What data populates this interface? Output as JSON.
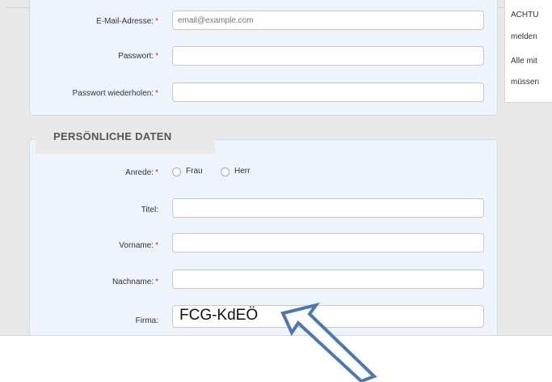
{
  "account": {
    "email_label": "E-Mail-Adresse:",
    "email_placeholder": "email@example.com",
    "password_label": "Passwort:",
    "password_repeat_label": "Passwort wiederholen:",
    "required_mark": "*"
  },
  "personal": {
    "legend": "PERSÖNLICHE DATEN",
    "salutation_label": "Anrede:",
    "option_frau": "Frau",
    "option_herr": "Herr",
    "title_label": "Titel:",
    "firstname_label": "Vorname:",
    "lastname_label": "Nachname:",
    "company_label": "Firma:",
    "company_value": "FCG-KdEÖ"
  },
  "side_note": {
    "line1": "ACHTU",
    "line2": "melden",
    "line3": "Alle mit",
    "line4": "müssen"
  },
  "colors": {
    "panel_bg": "#eef4fb",
    "required": "#e01f1f",
    "arrow_stroke": "#4a78b4"
  },
  "icons": {
    "annotation_arrow": "arrow-up-left-icon"
  }
}
